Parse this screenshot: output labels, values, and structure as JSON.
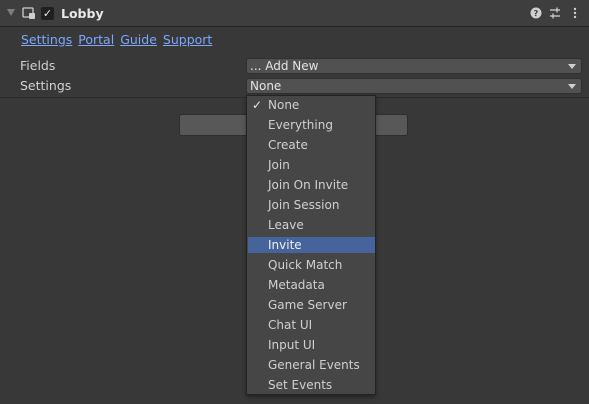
{
  "header": {
    "title": "Lobby",
    "enabled_check": "✓"
  },
  "links": [
    "Settings",
    "Portal",
    "Guide",
    "Support"
  ],
  "fields": {
    "label": "Fields",
    "value": "... Add New"
  },
  "settings": {
    "label": "Settings",
    "value": "None"
  },
  "menu": {
    "checked_index": 0,
    "highlighted_index": 7,
    "check_mark": "✓",
    "items": [
      "None",
      "Everything",
      "Create",
      "Join",
      "Join On Invite",
      "Join Session",
      "Leave",
      "Invite",
      "Quick Match",
      "Metadata",
      "Game Server",
      "Chat UI",
      "Input UI",
      "General Events",
      "Set Events"
    ]
  },
  "colors": {
    "accent_highlight": "#46639c",
    "link": "#7ba7ff"
  },
  "icons": {
    "foldout": "triangle-down-icon",
    "component": "component-icon",
    "help": "help-icon",
    "presets": "presets-icon",
    "more": "more-vertical-icon"
  }
}
